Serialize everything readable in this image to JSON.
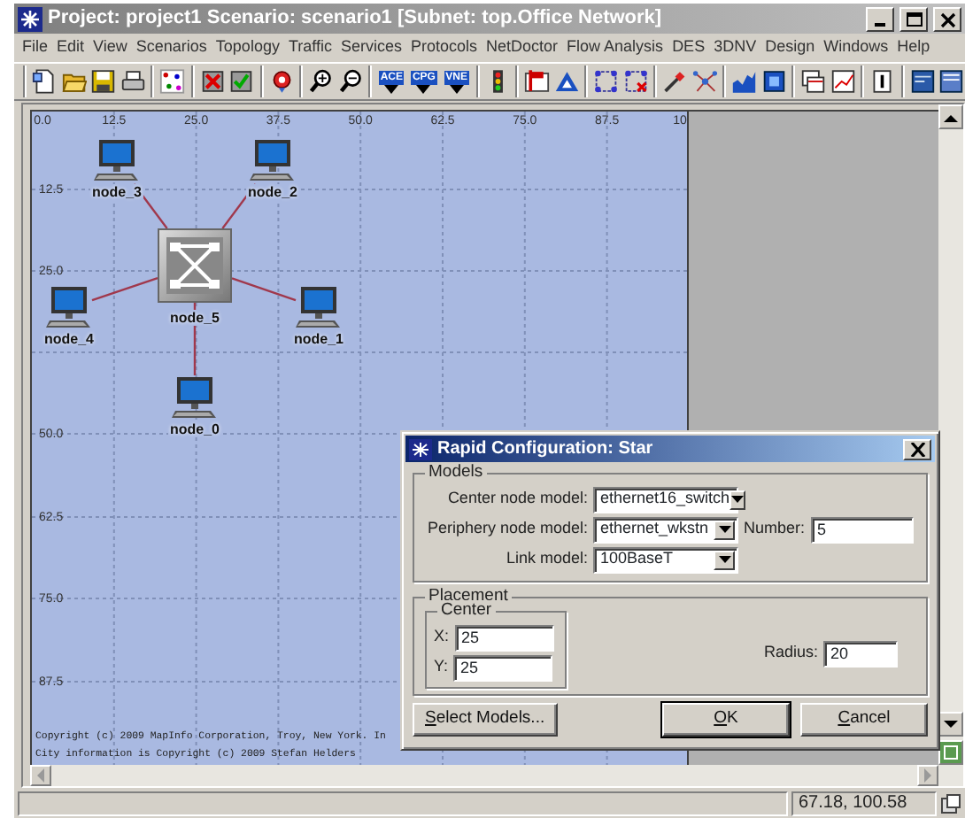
{
  "window": {
    "title": "Project: project1 Scenario: scenario1  [Subnet: top.Office Network]"
  },
  "menu": [
    "File",
    "Edit",
    "View",
    "Scenarios",
    "Topology",
    "Traffic",
    "Services",
    "Protocols",
    "NetDoctor",
    "Flow Analysis",
    "DES",
    "3DNV",
    "Design",
    "Windows",
    "Help"
  ],
  "toolbar_labels": [
    "ACE",
    "CPG",
    "VNE"
  ],
  "canvas": {
    "x_ticks": [
      "0.0",
      "12.5",
      "25.0",
      "37.5",
      "50.0",
      "62.5",
      "75.0",
      "87.5",
      "10"
    ],
    "y_ticks": [
      "12.5",
      "25.0",
      "50.0",
      "62.5",
      "75.0",
      "87.5"
    ],
    "nodes": [
      {
        "label": "node_3",
        "kind": "workstation"
      },
      {
        "label": "node_2",
        "kind": "workstation"
      },
      {
        "label": "node_5",
        "kind": "switch"
      },
      {
        "label": "node_4",
        "kind": "workstation"
      },
      {
        "label": "node_1",
        "kind": "workstation"
      },
      {
        "label": "node_0",
        "kind": "workstation"
      }
    ],
    "copyright": [
      "Copyright (c) 2009 MapInfo Corporation, Troy, New York. In",
      "City information is Copyright (c) 2009 Stefan Helders"
    ]
  },
  "dialog": {
    "title": "Rapid Configuration: Star",
    "models": {
      "legend": "Models",
      "rows": [
        [
          {
            "kind": "dropdown",
            "label": "Center node model:",
            "value": "ethernet16_switch"
          }
        ],
        [
          {
            "kind": "dropdown",
            "label": "Periphery node model:",
            "value": "ethernet_wkstn"
          },
          {
            "kind": "text",
            "label": "Number:",
            "value": "5"
          }
        ],
        [
          {
            "kind": "dropdown",
            "label": "Link model:",
            "value": "100BaseT"
          }
        ]
      ]
    },
    "placement": {
      "legend": "Placement",
      "center": {
        "legend": "Center",
        "fields": [
          {
            "label": "X:",
            "value": "25"
          },
          {
            "label": "Y:",
            "value": "25"
          }
        ]
      },
      "radius": {
        "label": "Radius:",
        "value": "20"
      }
    },
    "buttons": [
      {
        "label": "Select Models...",
        "default": false
      },
      {
        "label": "OK",
        "default": true
      },
      {
        "label": "Cancel",
        "default": false
      }
    ]
  },
  "status_bar": {
    "coordinates": "67.18, 100.58"
  }
}
